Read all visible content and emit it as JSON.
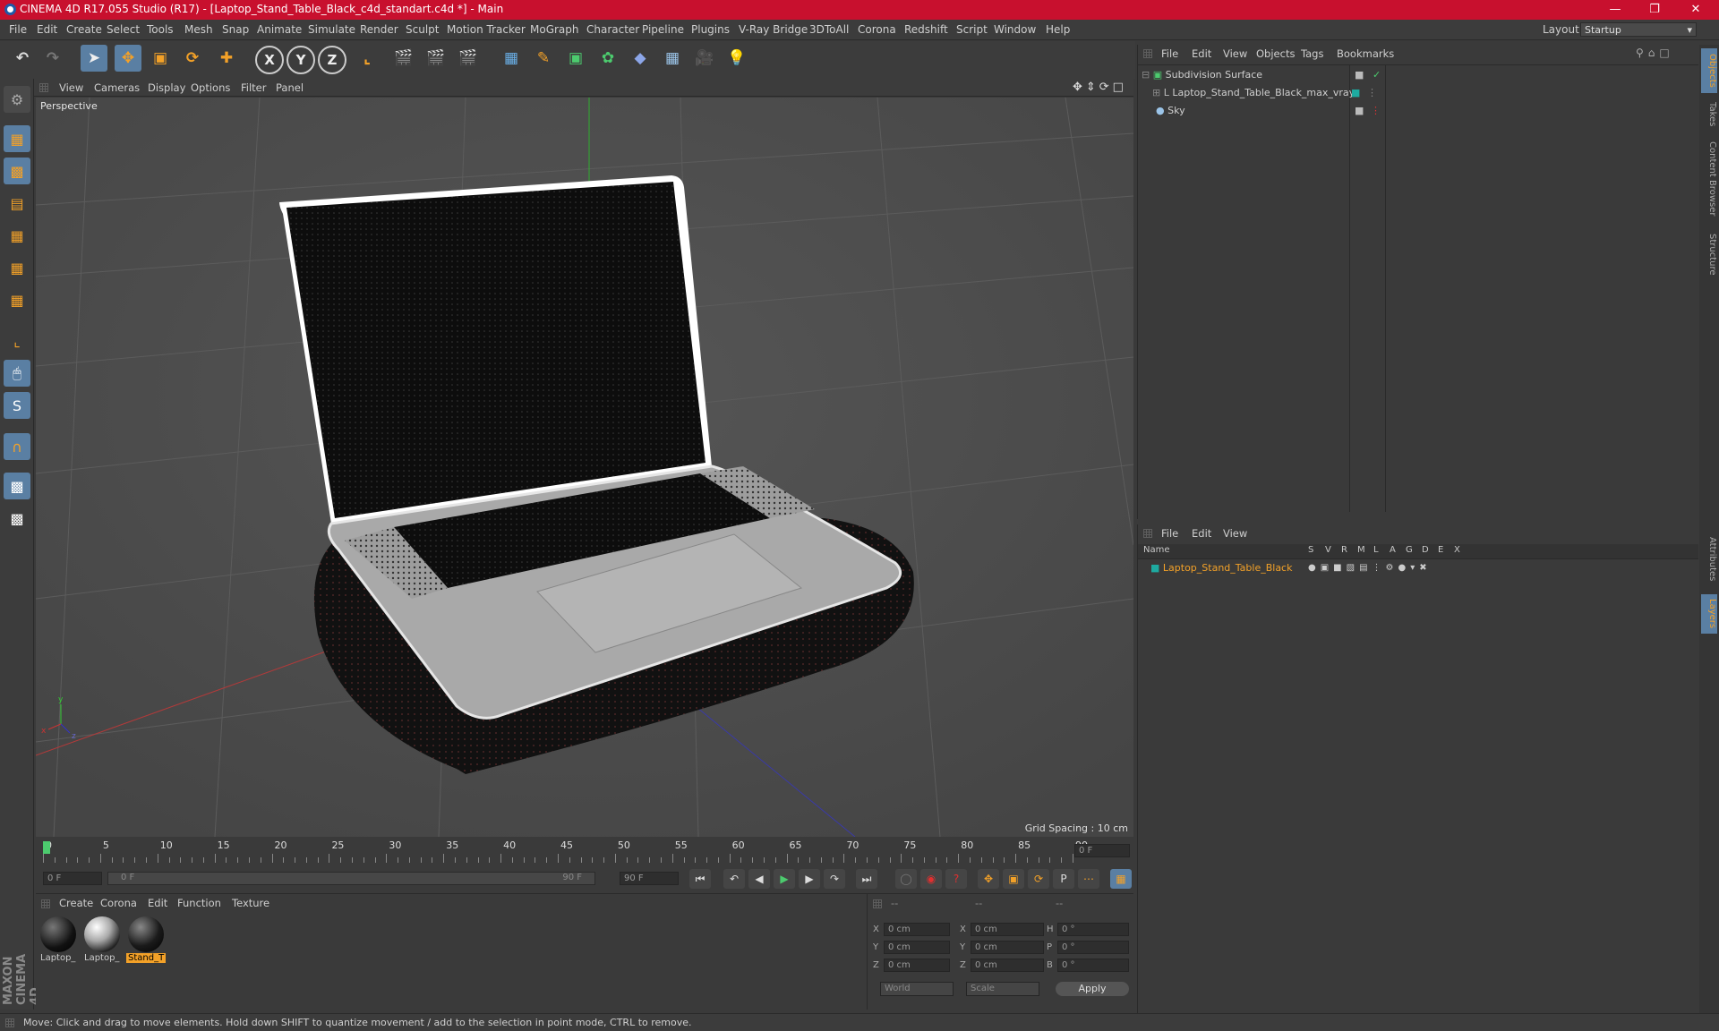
{
  "window": {
    "title": "CINEMA 4D R17.055 Studio (R17) - [Laptop_Stand_Table_Black_c4d_standart.c4d *] - Main"
  },
  "menubar": {
    "items": [
      "File",
      "Edit",
      "Create",
      "Select",
      "Tools",
      "Mesh",
      "Snap",
      "Animate",
      "Simulate",
      "Render",
      "Sculpt",
      "Motion Tracker",
      "MoGraph",
      "Character",
      "Pipeline",
      "Plugins",
      "V-Ray Bridge",
      "3DToAll",
      "Corona",
      "Redshift",
      "Script",
      "Window",
      "Help"
    ],
    "layout_label": "Layout:",
    "layout_value": "Startup"
  },
  "viewport": {
    "menu": [
      "View",
      "Cameras",
      "Display",
      "Options",
      "Filter",
      "Panel"
    ],
    "label": "Perspective",
    "grid_spacing": "Grid Spacing : 10 cm"
  },
  "timeline": {
    "ticks": [
      "0",
      "5",
      "10",
      "15",
      "20",
      "25",
      "30",
      "35",
      "40",
      "45",
      "50",
      "55",
      "60",
      "65",
      "70",
      "75",
      "80",
      "85",
      "90"
    ],
    "current_frame": "0 F"
  },
  "transport": {
    "start": "0 F",
    "range_start": "0 F",
    "range_end": "90 F",
    "end": "90 F"
  },
  "materials": {
    "menu": [
      "Create",
      "Corona",
      "Edit",
      "Function",
      "Texture"
    ],
    "items": [
      {
        "label": "Laptop_",
        "selected": false
      },
      {
        "label": "Laptop_",
        "selected": false
      },
      {
        "label": "Stand_T",
        "selected": true
      }
    ]
  },
  "coords": {
    "header": [
      "--",
      "--",
      "--"
    ],
    "rows": [
      {
        "a": "X",
        "av": "0 cm",
        "b": "X",
        "bv": "0 cm",
        "c": "H",
        "cv": "0 °"
      },
      {
        "a": "Y",
        "av": "0 cm",
        "b": "Y",
        "bv": "0 cm",
        "c": "P",
        "cv": "0 °"
      },
      {
        "a": "Z",
        "av": "0 cm",
        "b": "Z",
        "bv": "0 cm",
        "c": "B",
        "cv": "0 °"
      }
    ],
    "mode1": "World",
    "mode2": "Scale",
    "apply": "Apply"
  },
  "objects": {
    "menu": [
      "File",
      "Edit",
      "View",
      "Objects",
      "Tags",
      "Bookmarks"
    ],
    "tree": [
      {
        "name": "Subdivision Surface"
      },
      {
        "name": "Laptop_Stand_Table_Black_max_vray"
      },
      {
        "name": "Sky"
      }
    ]
  },
  "layers": {
    "menu": [
      "File",
      "Edit",
      "View"
    ],
    "columns": [
      "Name",
      "S",
      "V",
      "R",
      "M",
      "L",
      "A",
      "G",
      "D",
      "E",
      "X"
    ],
    "rows": [
      {
        "name": "Laptop_Stand_Table_Black"
      }
    ]
  },
  "sidetabs": [
    "Objects",
    "Takes",
    "Content Browser",
    "Structure",
    "Attributes",
    "Layers"
  ],
  "status": "Move: Click and drag to move elements. Hold down SHIFT to quantize movement / add to the selection in point mode, CTRL to remove.",
  "brand": "MAXON CINEMA 4D",
  "colors": {
    "title_bar": "#c8102e",
    "selection_blue": "#5a7fa3",
    "accent_orange": "#f3a128",
    "material_selected": "#f3a128"
  }
}
